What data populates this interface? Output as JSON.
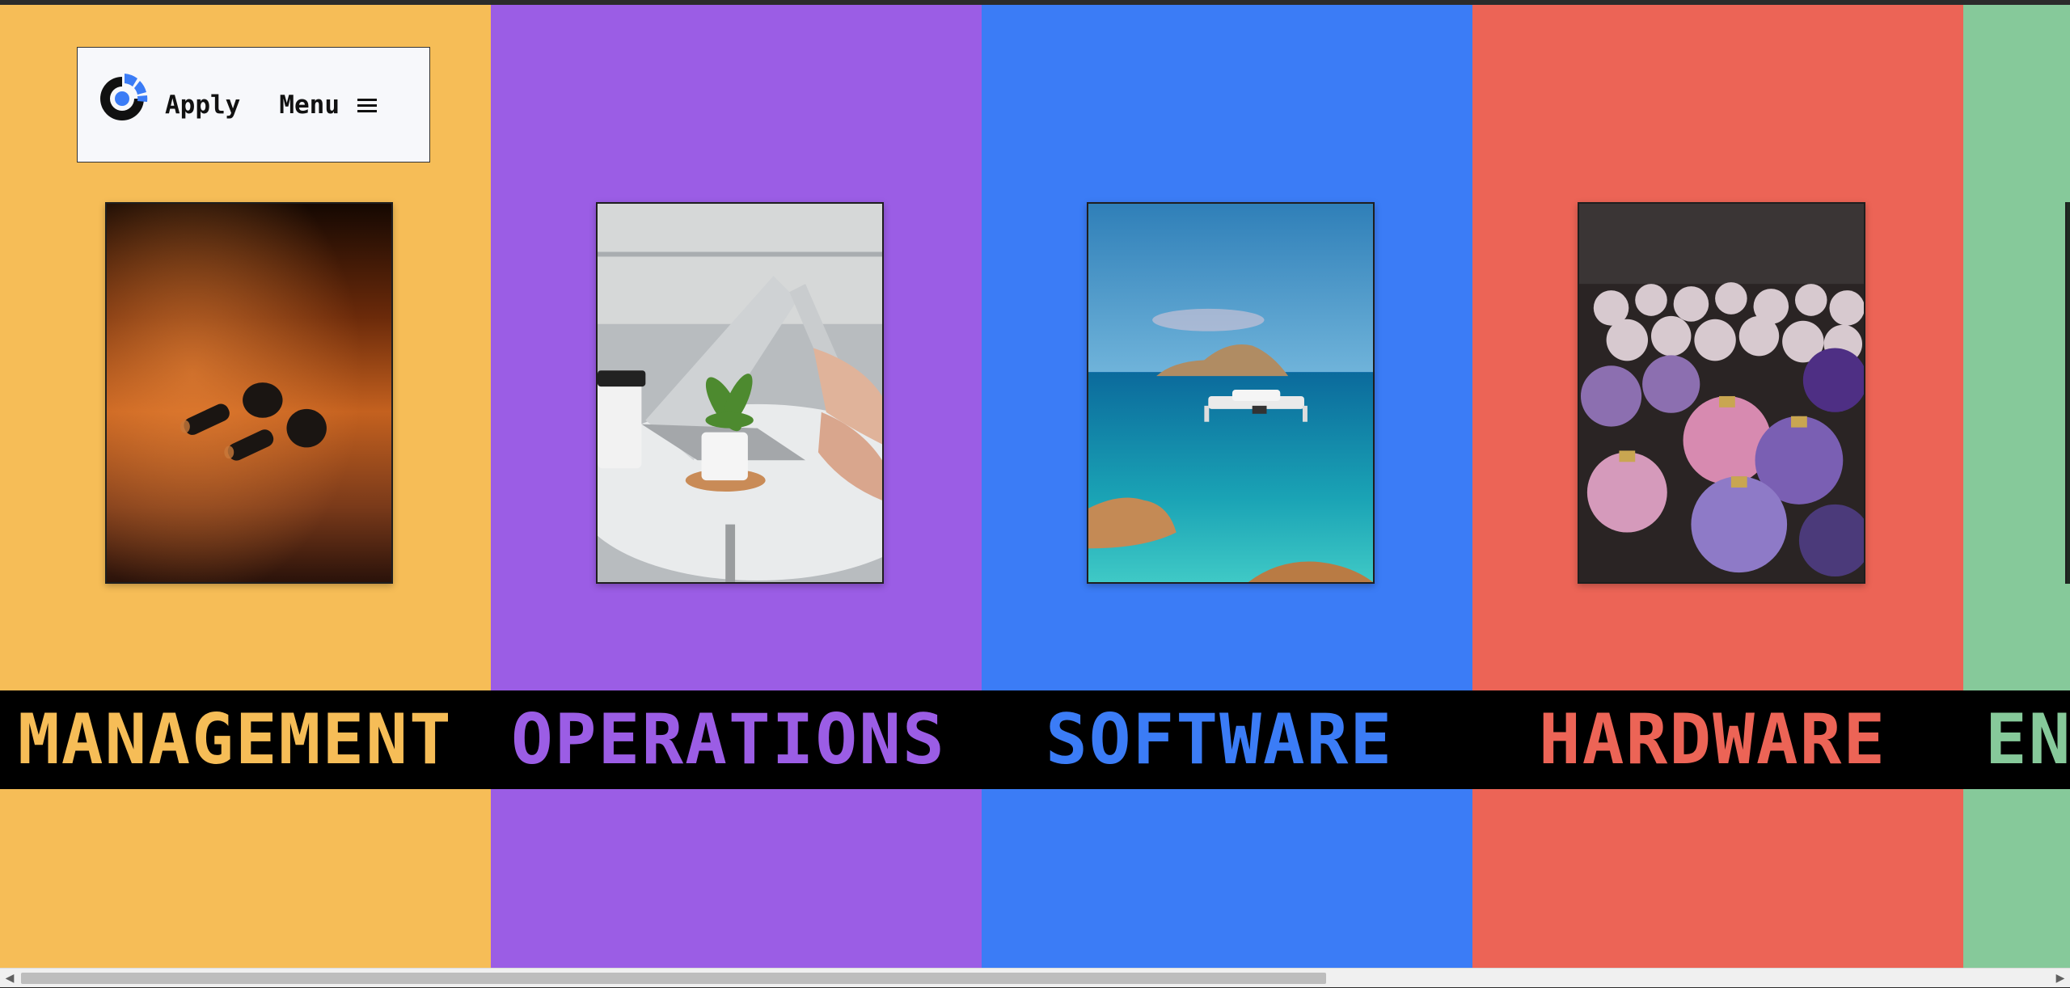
{
  "header": {
    "logo_icon": "company-logo-icon",
    "apply_label": "Apply",
    "menu_label": "Menu",
    "menu_icon": "hamburger-icon"
  },
  "columns": [
    {
      "label": "MANAGEMENT",
      "color": "#f6bd57",
      "photo": "earbuds-on-table"
    },
    {
      "label": "OPERATIONS",
      "color": "#9b5de5",
      "photo": "laptops-and-plant-on-desk"
    },
    {
      "label": "SOFTWARE",
      "color": "#3b7cf6",
      "photo": "drone-over-sea"
    },
    {
      "label": "HARDWARE",
      "color": "#ec6456",
      "photo": "glass-ornaments"
    },
    {
      "label": "EN",
      "color": "#86c99a",
      "photo": ""
    }
  ],
  "colors": {
    "band": "#000000",
    "logo_blue": "#3b7cf6",
    "logo_dark": "#111111"
  }
}
